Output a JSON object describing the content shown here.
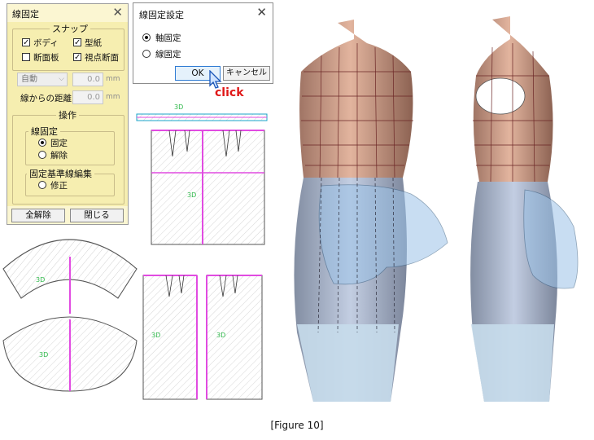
{
  "panel": {
    "title": "線固定",
    "close": "✕",
    "snap_group": "スナップ",
    "snap_items": [
      {
        "label": "ボディ",
        "checked": true
      },
      {
        "label": "型紙",
        "checked": true
      },
      {
        "label": "断面板",
        "checked": false
      },
      {
        "label": "視点断面",
        "checked": true
      }
    ],
    "mode_select": "自動",
    "mode_value": "0.0",
    "mode_unit": "mm",
    "distance_label": "線からの距離",
    "distance_value": "0.0",
    "distance_unit": "mm",
    "operation_group": "操作",
    "fix_group": "線固定",
    "fix_options": [
      {
        "label": "固定",
        "selected": true
      },
      {
        "label": "解除",
        "selected": false
      }
    ],
    "baseline_group": "固定基準線編集",
    "baseline_option": "修正",
    "clear_all_button": "全解除",
    "close_button": "閉じる"
  },
  "dialog": {
    "title": "線固定設定",
    "close": "✕",
    "options": [
      {
        "label": "軸固定",
        "selected": true
      },
      {
        "label": "線固定",
        "selected": false
      }
    ],
    "ok_button": "OK",
    "cancel_button": "キャンセル"
  },
  "annotation": "click",
  "pattern_tags": [
    "3D",
    "3D",
    "3D",
    "3D",
    "3D",
    "3D"
  ],
  "caption": "[Figure 10]"
}
